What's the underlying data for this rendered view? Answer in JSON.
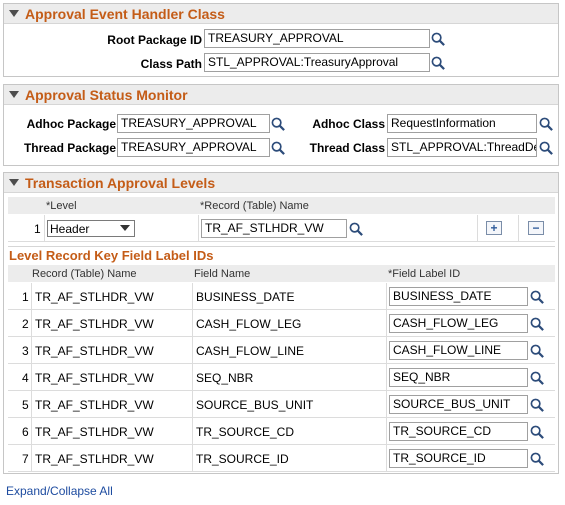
{
  "handler": {
    "title": "Approval Event Handler Class",
    "root_package_label": "Root Package ID",
    "root_package_value": "TREASURY_APPROVAL",
    "class_path_label": "Class Path",
    "class_path_value": "STL_APPROVAL:TreasuryApproval"
  },
  "monitor": {
    "title": "Approval Status Monitor",
    "adhoc_package_label": "Adhoc Package",
    "adhoc_package_value": "TREASURY_APPROVAL",
    "adhoc_class_label": "Adhoc Class",
    "adhoc_class_value": "RequestInformation",
    "thread_package_label": "Thread Package",
    "thread_package_value": "TREASURY_APPROVAL",
    "thread_class_label": "Thread Class",
    "thread_class_value": "STL_APPROVAL:ThreadDe"
  },
  "levels": {
    "title": "Transaction Approval Levels",
    "col_level": "*Level",
    "col_record": "*Record (Table) Name",
    "row_num": "1",
    "level_value": "Header",
    "record_value": "TR_AF_STLHDR_VW",
    "add_label": "+",
    "remove_label": "−"
  },
  "keyfields": {
    "title": "Level Record Key Field Label IDs",
    "col_record": "Record (Table) Name",
    "col_field": "Field Name",
    "col_label": "*Field Label ID",
    "rows": [
      {
        "n": "1",
        "record": "TR_AF_STLHDR_VW",
        "field": "BUSINESS_DATE",
        "label": "BUSINESS_DATE"
      },
      {
        "n": "2",
        "record": "TR_AF_STLHDR_VW",
        "field": "CASH_FLOW_LEG",
        "label": "CASH_FLOW_LEG"
      },
      {
        "n": "3",
        "record": "TR_AF_STLHDR_VW",
        "field": "CASH_FLOW_LINE",
        "label": "CASH_FLOW_LINE"
      },
      {
        "n": "4",
        "record": "TR_AF_STLHDR_VW",
        "field": "SEQ_NBR",
        "label": "SEQ_NBR"
      },
      {
        "n": "5",
        "record": "TR_AF_STLHDR_VW",
        "field": "SOURCE_BUS_UNIT",
        "label": "SOURCE_BUS_UNIT"
      },
      {
        "n": "6",
        "record": "TR_AF_STLHDR_VW",
        "field": "TR_SOURCE_CD",
        "label": "TR_SOURCE_CD"
      },
      {
        "n": "7",
        "record": "TR_AF_STLHDR_VW",
        "field": "TR_SOURCE_ID",
        "label": "TR_SOURCE_ID"
      }
    ]
  },
  "footer": {
    "expand_collapse": "Expand/Collapse All"
  },
  "icons": {
    "lookup": "magnifier-icon",
    "collapse": "triangle-down-icon"
  },
  "colors": {
    "section_title": "#c45c17",
    "link": "#1e4ca0"
  }
}
